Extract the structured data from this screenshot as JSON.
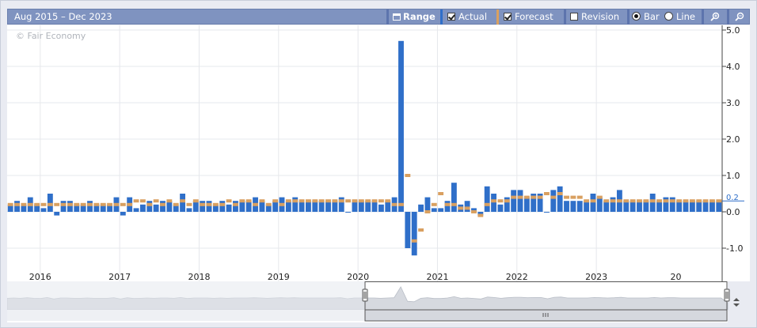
{
  "header": {
    "range_title": "Aug 2015 – Dec 2023",
    "range_label": "Range",
    "actual_label": "Actual",
    "forecast_label": "Forecast",
    "revision_label": "Revision",
    "bar_label": "Bar",
    "line_label": "Line",
    "actual_checked": true,
    "forecast_checked": true,
    "revision_checked": false,
    "chart_mode": "Bar"
  },
  "watermark": "© Fair Economy",
  "colors": {
    "actual": "#2f6fc9",
    "forecast": "#d9a060",
    "toolbar": "#7f93c0",
    "navigator_fill": "#d6d9df"
  },
  "chart_data": {
    "type": "bar",
    "x_start": "2015-08",
    "x_end": "2023-12",
    "x_axis_tick_labels": [
      "2016",
      "2017",
      "2018",
      "2019",
      "2020",
      "2021",
      "2022",
      "2023",
      "20"
    ],
    "y_axis_tick_labels": [
      "5.0",
      "4.0",
      "3.0",
      "2.0",
      "1.0",
      "0.0",
      "-1.0"
    ],
    "ylim": [
      -1.25,
      5.0
    ],
    "current_value_label": "0.2",
    "grid": true,
    "series": [
      {
        "name": "Actual",
        "kind": "bar",
        "values": [
          0.2,
          0.3,
          0.2,
          0.4,
          0.2,
          0.1,
          0.5,
          -0.1,
          0.3,
          0.3,
          0.2,
          0.2,
          0.3,
          0.2,
          0.2,
          0.2,
          0.4,
          -0.1,
          0.4,
          0.1,
          0.2,
          0.3,
          0.2,
          0.3,
          0.3,
          0.2,
          0.5,
          0.1,
          0.3,
          0.3,
          0.3,
          0.2,
          0.3,
          0.2,
          0.3,
          0.3,
          0.3,
          0.4,
          0.3,
          0.2,
          0.3,
          0.4,
          0.3,
          0.4,
          0.3,
          0.3,
          0.3,
          0.3,
          0.3,
          0.3,
          0.4,
          0.0,
          0.3,
          0.3,
          0.3,
          0.3,
          0.2,
          0.3,
          0.4,
          4.7,
          -1.0,
          -1.2,
          0.2,
          0.4,
          0.1,
          0.1,
          0.3,
          0.8,
          0.2,
          0.3,
          0.1,
          -0.1,
          0.7,
          0.5,
          0.2,
          0.4,
          0.6,
          0.6,
          0.4,
          0.5,
          0.5,
          0.0,
          0.6,
          0.7,
          0.3,
          0.3,
          0.3,
          0.3,
          0.5,
          0.4,
          0.3,
          0.4,
          0.6,
          0.3,
          0.3,
          0.3,
          0.3,
          0.5,
          0.3,
          0.4,
          0.4,
          0.3,
          0.3,
          0.3,
          0.3,
          0.3,
          0.3,
          0.3
        ],
        "color": "#2f6fc9"
      },
      {
        "name": "Forecast",
        "kind": "marker",
        "values": [
          0.2,
          0.2,
          0.2,
          0.2,
          0.2,
          0.2,
          0.2,
          0.2,
          0.2,
          0.2,
          0.2,
          0.2,
          0.2,
          0.2,
          0.2,
          0.2,
          0.2,
          0.2,
          0.2,
          0.3,
          0.3,
          0.2,
          0.3,
          0.2,
          0.3,
          0.2,
          0.3,
          0.2,
          0.3,
          0.2,
          0.2,
          0.2,
          0.2,
          0.3,
          0.2,
          0.3,
          0.3,
          0.2,
          0.3,
          0.2,
          0.3,
          0.2,
          0.3,
          0.3,
          0.3,
          0.3,
          0.3,
          0.3,
          0.3,
          0.3,
          0.3,
          0.3,
          0.3,
          0.3,
          0.3,
          0.3,
          0.3,
          0.3,
          0.2,
          0.2,
          1.0,
          -0.8,
          -0.5,
          0.0,
          0.2,
          0.5,
          0.2,
          0.2,
          0.1,
          0.1,
          0.0,
          -0.1,
          0.2,
          0.3,
          0.3,
          0.3,
          0.4,
          0.4,
          0.4,
          0.4,
          0.4,
          0.5,
          0.4,
          0.5,
          0.4,
          0.4,
          0.4,
          0.3,
          0.3,
          0.4,
          0.3,
          0.3,
          0.3,
          0.3,
          0.3,
          0.3,
          0.3,
          0.3,
          0.3,
          0.3,
          0.3,
          0.3,
          0.3,
          0.3,
          0.3,
          0.3,
          0.3,
          0.3
        ],
        "color": "#d9a060"
      }
    ]
  }
}
